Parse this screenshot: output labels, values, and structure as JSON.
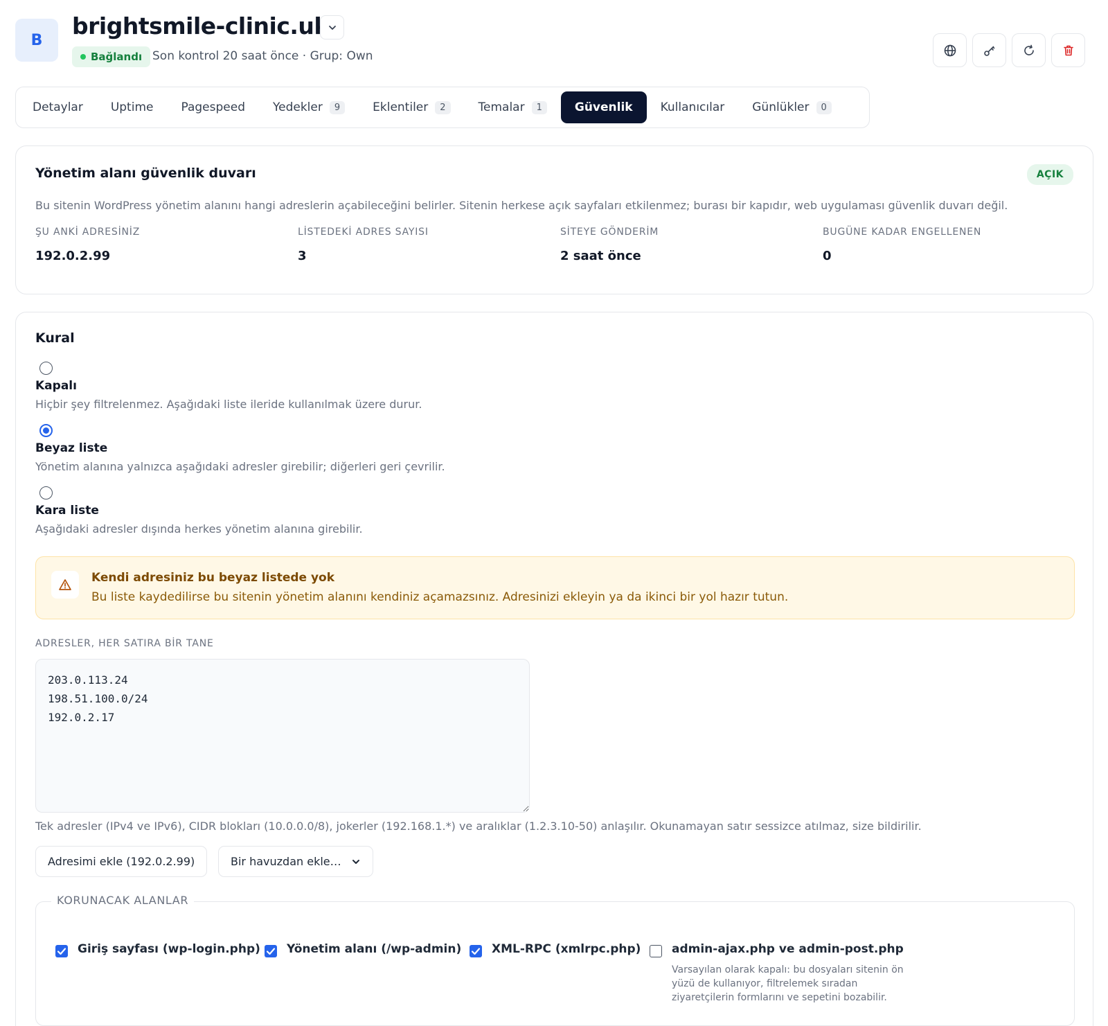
{
  "header": {
    "avatar_letter": "B",
    "site_name": "brightsmile-clinic.uk",
    "status_label": "Bağlandı",
    "status_detail": "Son kontrol 20 saat önce · Grup: Own",
    "actions": [
      "globe-icon",
      "key-icon",
      "refresh-icon",
      "trash-icon"
    ],
    "colors": {
      "status_green": "#22c55e",
      "danger": "#dc2626",
      "accent": "#2563eb",
      "active_tab": "#0b1530"
    }
  },
  "tabs": [
    {
      "label": "Detaylar",
      "badge": null
    },
    {
      "label": "Uptime",
      "badge": null
    },
    {
      "label": "Pagespeed",
      "badge": null
    },
    {
      "label": "Yedekler",
      "badge": "9"
    },
    {
      "label": "Eklentiler",
      "badge": "2"
    },
    {
      "label": "Temalar",
      "badge": "1"
    },
    {
      "label": "Güvenlik",
      "badge": null,
      "active": true
    },
    {
      "label": "Kullanıcılar",
      "badge": null
    },
    {
      "label": "Günlükler",
      "badge": "0"
    }
  ],
  "firewall": {
    "title": "Yönetim alanı güvenlik duvarı",
    "state_badge": "AÇIK",
    "description": "Bu sitenin WordPress yönetim alanını hangi adreslerin açabileceğini belirler. Sitenin herkese açık sayfaları etkilenmez; burası bir kapıdır, web uygulaması güvenlik duvarı değil.",
    "stats": [
      {
        "label": "ŞU ANKİ ADRESİNİZ",
        "value": "192.0.2.99"
      },
      {
        "label": "LİSTEDEKİ ADRES SAYISI",
        "value": "3"
      },
      {
        "label": "SİTEYE GÖNDERİM",
        "value": "2 saat önce"
      },
      {
        "label": "BUGÜNE KADAR ENGELLENEN",
        "value": "0"
      }
    ]
  },
  "rule": {
    "title": "Kural",
    "options": [
      {
        "title": "Kapalı",
        "desc": "Hiçbir şey filtrelenmez. Aşağıdaki liste ileride kullanılmak üzere durur.",
        "selected": false
      },
      {
        "title": "Beyaz liste",
        "desc": "Yönetim alanına yalnızca aşağıdaki adresler girebilir; diğerleri geri çevrilir.",
        "selected": true
      },
      {
        "title": "Kara liste",
        "desc": "Aşağıdaki adresler dışında herkes yönetim alanına girebilir.",
        "selected": false
      }
    ],
    "warning": {
      "title": "Kendi adresiniz bu beyaz listede yok",
      "text": "Bu liste kaydedilirse bu sitenin yönetim alanını kendiniz açamazsınız. Adresinizi ekleyin ya da ikinci bir yol hazır tutun."
    },
    "addresses_label": "ADRESLER, HER SATIRA BİR TANE",
    "addresses": [
      "203.0.113.24",
      "198.51.100.0/24",
      "192.0.2.17"
    ],
    "help": "Tek adresler (IPv4 ve IPv6), CIDR blokları (10.0.0.0/8), jokerler (192.168.1.*) ve aralıklar (1.2.3.10-50) anlaşılır. Okunamayan satır sessizce atılmaz, size bildirilir.",
    "add_mine_button": "Adresimi ekle (192.0.2.99)",
    "pool_select": "Bir havuzdan ekle…"
  },
  "protected": {
    "legend": "KORUNACAK ALANLAR",
    "items": [
      {
        "label": "Giriş sayfası (wp-login.php)",
        "checked": true
      },
      {
        "label": "Yönetim alanı (/wp-admin)",
        "checked": true
      },
      {
        "label": "XML-RPC (xmlrpc.php)",
        "checked": true
      },
      {
        "label": "admin-ajax.php ve admin-post.php",
        "checked": false
      }
    ],
    "note": "Varsayılan olarak kapalı: bu dosyaları sitenin ön yüzü de kullanıyor, filtrelemek sıradan ziyaretçilerin formlarını ve sepetini bozabilir."
  }
}
